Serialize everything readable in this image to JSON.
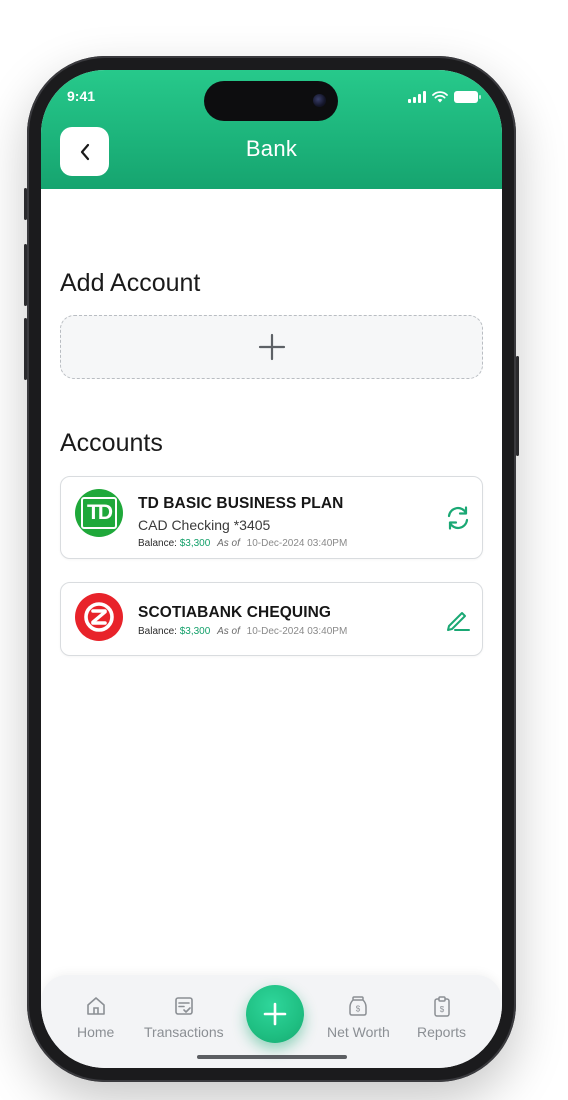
{
  "status_bar": {
    "time": "9:41"
  },
  "header": {
    "title": "Bank",
    "back_icon": "chevron-left-icon"
  },
  "add_account": {
    "title": "Add Account",
    "add_icon": "plus-icon"
  },
  "accounts": {
    "title": "Accounts",
    "items": [
      {
        "name": "TD BASIC BUSINESS PLAN",
        "subtitle": "CAD Checking *3405",
        "balance_label": "Balance:",
        "balance_value": "$3,300",
        "as_of_label": "As of",
        "as_of_date": "10-Dec-2024  03:40PM",
        "logo_text": "TD",
        "logo_color": "#1fa83a",
        "action_icon": "refresh-icon"
      },
      {
        "name": "SCOTIABANK CHEQUING",
        "balance_label": "Balance:",
        "balance_value": "$3,300",
        "as_of_label": "As of",
        "as_of_date": "10-Dec-2024  03:40PM",
        "logo_color": "#e8232a",
        "action_icon": "pencil-icon"
      }
    ]
  },
  "tabbar": {
    "items": [
      {
        "label": "Home",
        "icon": "home-icon"
      },
      {
        "label": "Transactions",
        "icon": "transactions-icon"
      },
      {
        "label": "Net Worth",
        "icon": "money-jar-icon"
      },
      {
        "label": "Reports",
        "icon": "clipboard-dollar-icon"
      }
    ],
    "fab_icon": "plus-icon"
  },
  "colors": {
    "accent": "#1db57c",
    "balance_green": "#14a06a"
  }
}
